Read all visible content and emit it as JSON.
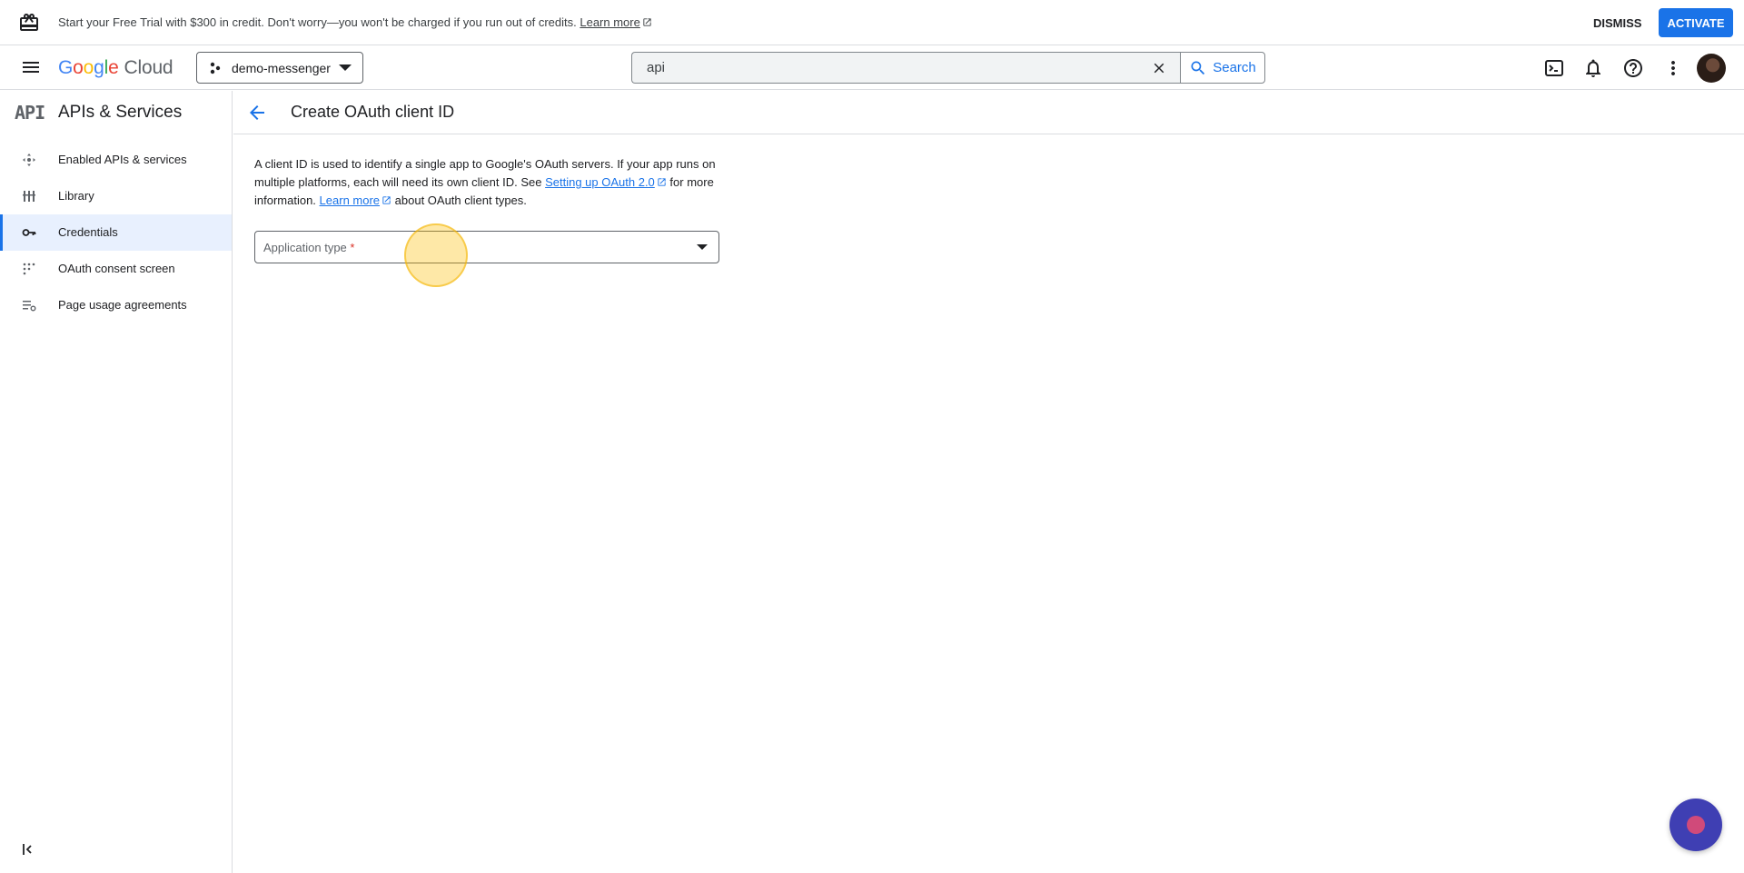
{
  "banner": {
    "message": "Start your Free Trial with $300 in credit. Don't worry—you won't be charged if you run out of credits.",
    "learn_more": "Learn more",
    "dismiss": "DISMISS",
    "activate": "ACTIVATE"
  },
  "topnav": {
    "logo_google": [
      "G",
      "o",
      "o",
      "g",
      "l",
      "e"
    ],
    "logo_cloud": "Cloud",
    "project_name": "demo-messenger",
    "search_value": "api",
    "search_button": "Search"
  },
  "sidebar": {
    "logo_text": "API",
    "title": "APIs & Services",
    "items": [
      {
        "label": "Enabled APIs & services",
        "icon": "enabled-apis-icon",
        "active": false
      },
      {
        "label": "Library",
        "icon": "library-icon",
        "active": false
      },
      {
        "label": "Credentials",
        "icon": "key-icon",
        "active": true
      },
      {
        "label": "OAuth consent screen",
        "icon": "consent-icon",
        "active": false
      },
      {
        "label": "Page usage agreements",
        "icon": "agreements-icon",
        "active": false
      }
    ]
  },
  "page": {
    "title": "Create OAuth client ID",
    "desc_part1": "A client ID is used to identify a single app to Google's OAuth servers. If your app runs on multiple platforms, each will need its own client ID. See ",
    "desc_link1": "Setting up OAuth 2.0",
    "desc_part2": " for more information. ",
    "desc_link2": "Learn more",
    "desc_part3": " about OAuth client types.",
    "app_type_label": "Application type",
    "required_marker": "*"
  },
  "colors": {
    "accent": "#1a73e8",
    "active_bg": "#e8f0fe",
    "fab": "#3f3fb3"
  }
}
